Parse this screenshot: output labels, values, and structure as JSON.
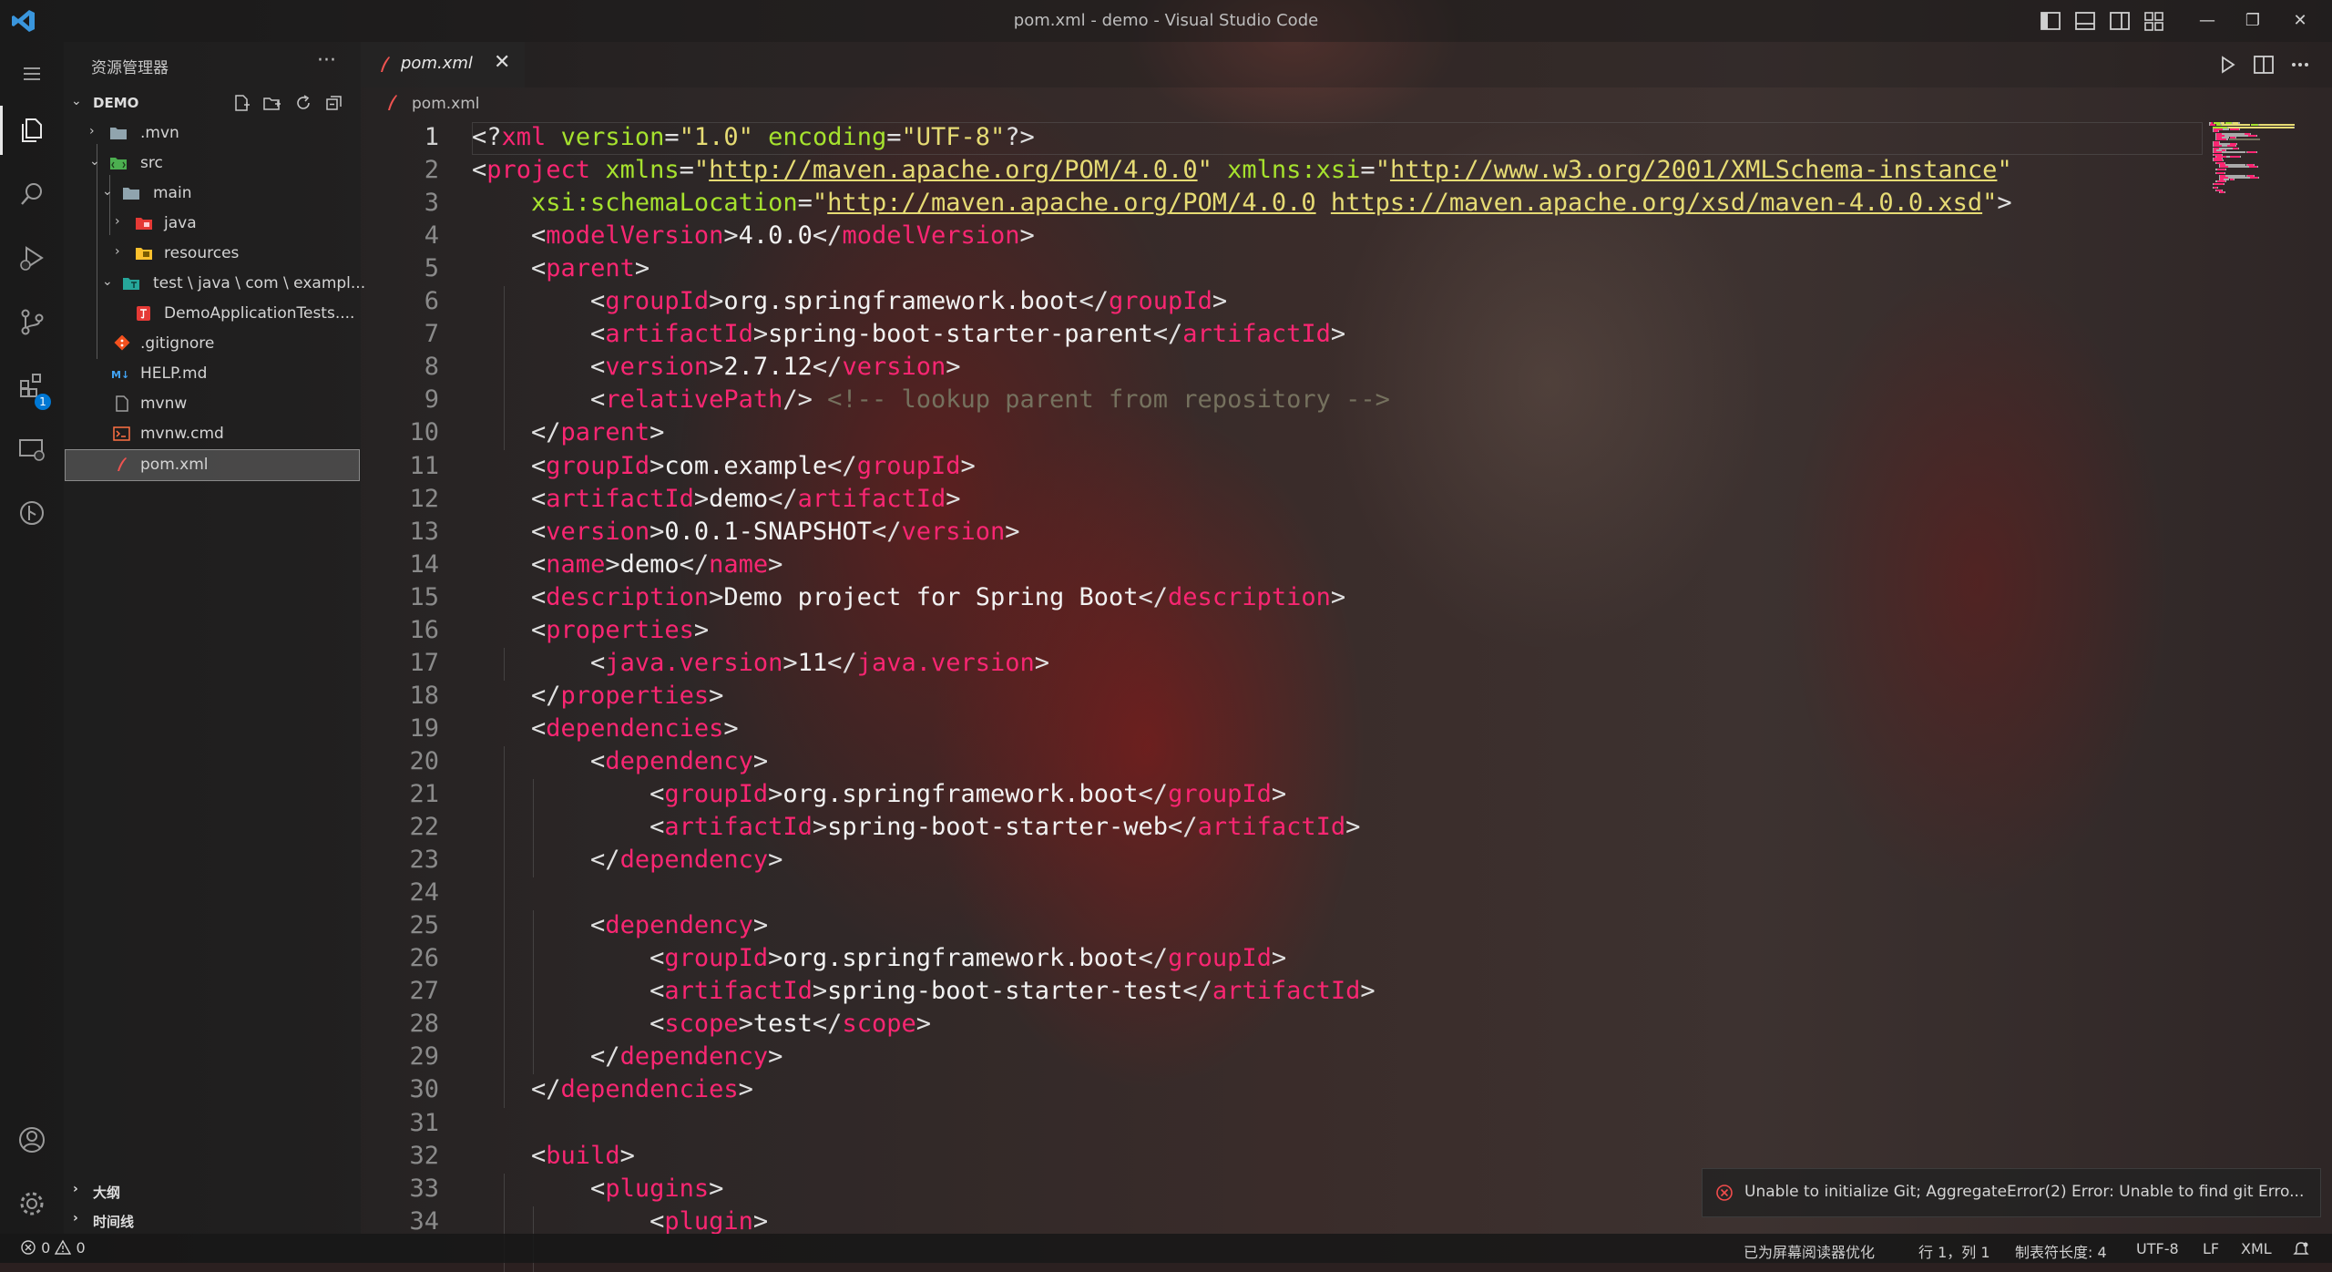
{
  "window": {
    "title": "pom.xml - demo - Visual Studio Code"
  },
  "titlebar": {
    "window_controls": [
      "—",
      "❐",
      "✕"
    ],
    "colors": {
      "accent": "#0078d4"
    }
  },
  "activity_bar": {
    "icons": [
      "menu-icon",
      "files-icon",
      "search-icon",
      "run-debug-icon",
      "source-control-icon",
      "extensions-icon",
      "remote-explorer-icon",
      "git-graph-icon",
      "account-icon",
      "gear-icon"
    ],
    "extensions_badge": "1"
  },
  "sidebar": {
    "title": "资源管理器",
    "more": "···",
    "root": "DEMO",
    "tree": [
      {
        "label": ".mvn",
        "chev": "›"
      },
      {
        "label": "src",
        "chev": "⌄"
      },
      {
        "label": "main",
        "chev": "⌄"
      },
      {
        "label": "java",
        "chev": "›"
      },
      {
        "label": "resources",
        "chev": "›"
      },
      {
        "label": "test \\ java \\ com \\ exampl...",
        "chev": "⌄"
      },
      {
        "label": "DemoApplicationTests...."
      },
      {
        "label": ".gitignore"
      },
      {
        "label": "HELP.md"
      },
      {
        "label": "mvnw"
      },
      {
        "label": "mvnw.cmd"
      },
      {
        "label": "pom.xml"
      }
    ],
    "outline": "大纲",
    "timeline": "时间线"
  },
  "tabs": [
    {
      "label": "pom.xml",
      "close": "✕"
    }
  ],
  "breadcrumb": {
    "file": "pom.xml"
  },
  "editor": {
    "line_numbers": [
      "1",
      "2",
      "3",
      "4",
      "5",
      "6",
      "7",
      "8",
      "9",
      "10",
      "11",
      "12",
      "13",
      "14",
      "15",
      "16",
      "17",
      "18",
      "19",
      "20",
      "21",
      "22",
      "23",
      "24",
      "25",
      "26",
      "27",
      "28",
      "29",
      "30",
      "31",
      "32",
      "33",
      "34"
    ],
    "lines": [
      [
        [
          "br",
          "<?"
        ],
        [
          "tag",
          "xml"
        ],
        [
          "txt",
          " "
        ],
        [
          "attr",
          "version"
        ],
        [
          "br",
          "="
        ],
        [
          "str",
          "\"1.0\""
        ],
        [
          "txt",
          " "
        ],
        [
          "attr",
          "encoding"
        ],
        [
          "br",
          "="
        ],
        [
          "str",
          "\"UTF-8\""
        ],
        [
          "br",
          "?>"
        ]
      ],
      [
        [
          "br",
          "<"
        ],
        [
          "tag",
          "project"
        ],
        [
          "txt",
          " "
        ],
        [
          "attr",
          "xmlns"
        ],
        [
          "br",
          "="
        ],
        [
          "str",
          "\""
        ],
        [
          "url",
          "http://maven.apache.org/POM/4.0.0"
        ],
        [
          "str",
          "\""
        ],
        [
          "txt",
          " "
        ],
        [
          "attr",
          "xmlns:xsi"
        ],
        [
          "br",
          "="
        ],
        [
          "str",
          "\""
        ],
        [
          "url",
          "http://www.w3.org/2001/XMLSchema-instance"
        ],
        [
          "str",
          "\""
        ]
      ],
      [
        [
          "txt",
          "    "
        ],
        [
          "attr",
          "xsi:schemaLocation"
        ],
        [
          "br",
          "="
        ],
        [
          "str",
          "\""
        ],
        [
          "url",
          "http://maven.apache.org/POM/4.0.0"
        ],
        [
          "str",
          " "
        ],
        [
          "url",
          "https://maven.apache.org/xsd/maven-4.0.0.xsd"
        ],
        [
          "str",
          "\""
        ],
        [
          "br",
          ">"
        ]
      ],
      [
        [
          "txt",
          "    "
        ],
        [
          "br",
          "<"
        ],
        [
          "tag",
          "modelVersion"
        ],
        [
          "br",
          ">"
        ],
        [
          "txt",
          "4.0.0"
        ],
        [
          "br",
          "</"
        ],
        [
          "tag",
          "modelVersion"
        ],
        [
          "br",
          ">"
        ]
      ],
      [
        [
          "txt",
          "    "
        ],
        [
          "br",
          "<"
        ],
        [
          "tag",
          "parent"
        ],
        [
          "br",
          ">"
        ]
      ],
      [
        [
          "txt",
          "        "
        ],
        [
          "br",
          "<"
        ],
        [
          "tag",
          "groupId"
        ],
        [
          "br",
          ">"
        ],
        [
          "txt",
          "org.springframework.boot"
        ],
        [
          "br",
          "</"
        ],
        [
          "tag",
          "groupId"
        ],
        [
          "br",
          ">"
        ]
      ],
      [
        [
          "txt",
          "        "
        ],
        [
          "br",
          "<"
        ],
        [
          "tag",
          "artifactId"
        ],
        [
          "br",
          ">"
        ],
        [
          "txt",
          "spring-boot-starter-parent"
        ],
        [
          "br",
          "</"
        ],
        [
          "tag",
          "artifactId"
        ],
        [
          "br",
          ">"
        ]
      ],
      [
        [
          "txt",
          "        "
        ],
        [
          "br",
          "<"
        ],
        [
          "tag",
          "version"
        ],
        [
          "br",
          ">"
        ],
        [
          "txt",
          "2.7.12"
        ],
        [
          "br",
          "</"
        ],
        [
          "tag",
          "version"
        ],
        [
          "br",
          ">"
        ]
      ],
      [
        [
          "txt",
          "        "
        ],
        [
          "br",
          "<"
        ],
        [
          "tag",
          "relativePath"
        ],
        [
          "br",
          "/>"
        ],
        [
          "txt",
          " "
        ],
        [
          "com",
          "<!-- lookup parent from repository -->"
        ]
      ],
      [
        [
          "txt",
          "    "
        ],
        [
          "br",
          "</"
        ],
        [
          "tag",
          "parent"
        ],
        [
          "br",
          ">"
        ]
      ],
      [
        [
          "txt",
          "    "
        ],
        [
          "br",
          "<"
        ],
        [
          "tag",
          "groupId"
        ],
        [
          "br",
          ">"
        ],
        [
          "txt",
          "com.example"
        ],
        [
          "br",
          "</"
        ],
        [
          "tag",
          "groupId"
        ],
        [
          "br",
          ">"
        ]
      ],
      [
        [
          "txt",
          "    "
        ],
        [
          "br",
          "<"
        ],
        [
          "tag",
          "artifactId"
        ],
        [
          "br",
          ">"
        ],
        [
          "txt",
          "demo"
        ],
        [
          "br",
          "</"
        ],
        [
          "tag",
          "artifactId"
        ],
        [
          "br",
          ">"
        ]
      ],
      [
        [
          "txt",
          "    "
        ],
        [
          "br",
          "<"
        ],
        [
          "tag",
          "version"
        ],
        [
          "br",
          ">"
        ],
        [
          "txt",
          "0.0.1-SNAPSHOT"
        ],
        [
          "br",
          "</"
        ],
        [
          "tag",
          "version"
        ],
        [
          "br",
          ">"
        ]
      ],
      [
        [
          "txt",
          "    "
        ],
        [
          "br",
          "<"
        ],
        [
          "tag",
          "name"
        ],
        [
          "br",
          ">"
        ],
        [
          "txt",
          "demo"
        ],
        [
          "br",
          "</"
        ],
        [
          "tag",
          "name"
        ],
        [
          "br",
          ">"
        ]
      ],
      [
        [
          "txt",
          "    "
        ],
        [
          "br",
          "<"
        ],
        [
          "tag",
          "description"
        ],
        [
          "br",
          ">"
        ],
        [
          "txt",
          "Demo project for Spring Boot"
        ],
        [
          "br",
          "</"
        ],
        [
          "tag",
          "description"
        ],
        [
          "br",
          ">"
        ]
      ],
      [
        [
          "txt",
          "    "
        ],
        [
          "br",
          "<"
        ],
        [
          "tag",
          "properties"
        ],
        [
          "br",
          ">"
        ]
      ],
      [
        [
          "txt",
          "        "
        ],
        [
          "br",
          "<"
        ],
        [
          "tag",
          "java.version"
        ],
        [
          "br",
          ">"
        ],
        [
          "txt",
          "11"
        ],
        [
          "br",
          "</"
        ],
        [
          "tag",
          "java.version"
        ],
        [
          "br",
          ">"
        ]
      ],
      [
        [
          "txt",
          "    "
        ],
        [
          "br",
          "</"
        ],
        [
          "tag",
          "properties"
        ],
        [
          "br",
          ">"
        ]
      ],
      [
        [
          "txt",
          "    "
        ],
        [
          "br",
          "<"
        ],
        [
          "tag",
          "dependencies"
        ],
        [
          "br",
          ">"
        ]
      ],
      [
        [
          "txt",
          "        "
        ],
        [
          "br",
          "<"
        ],
        [
          "tag",
          "dependency"
        ],
        [
          "br",
          ">"
        ]
      ],
      [
        [
          "txt",
          "            "
        ],
        [
          "br",
          "<"
        ],
        [
          "tag",
          "groupId"
        ],
        [
          "br",
          ">"
        ],
        [
          "txt",
          "org.springframework.boot"
        ],
        [
          "br",
          "</"
        ],
        [
          "tag",
          "groupId"
        ],
        [
          "br",
          ">"
        ]
      ],
      [
        [
          "txt",
          "            "
        ],
        [
          "br",
          "<"
        ],
        [
          "tag",
          "artifactId"
        ],
        [
          "br",
          ">"
        ],
        [
          "txt",
          "spring-boot-starter-web"
        ],
        [
          "br",
          "</"
        ],
        [
          "tag",
          "artifactId"
        ],
        [
          "br",
          ">"
        ]
      ],
      [
        [
          "txt",
          "        "
        ],
        [
          "br",
          "</"
        ],
        [
          "tag",
          "dependency"
        ],
        [
          "br",
          ">"
        ]
      ],
      [],
      [
        [
          "txt",
          "        "
        ],
        [
          "br",
          "<"
        ],
        [
          "tag",
          "dependency"
        ],
        [
          "br",
          ">"
        ]
      ],
      [
        [
          "txt",
          "            "
        ],
        [
          "br",
          "<"
        ],
        [
          "tag",
          "groupId"
        ],
        [
          "br",
          ">"
        ],
        [
          "txt",
          "org.springframework.boot"
        ],
        [
          "br",
          "</"
        ],
        [
          "tag",
          "groupId"
        ],
        [
          "br",
          ">"
        ]
      ],
      [
        [
          "txt",
          "            "
        ],
        [
          "br",
          "<"
        ],
        [
          "tag",
          "artifactId"
        ],
        [
          "br",
          ">"
        ],
        [
          "txt",
          "spring-boot-starter-test"
        ],
        [
          "br",
          "</"
        ],
        [
          "tag",
          "artifactId"
        ],
        [
          "br",
          ">"
        ]
      ],
      [
        [
          "txt",
          "            "
        ],
        [
          "br",
          "<"
        ],
        [
          "tag",
          "scope"
        ],
        [
          "br",
          ">"
        ],
        [
          "txt",
          "test"
        ],
        [
          "br",
          "</"
        ],
        [
          "tag",
          "scope"
        ],
        [
          "br",
          ">"
        ]
      ],
      [
        [
          "txt",
          "        "
        ],
        [
          "br",
          "</"
        ],
        [
          "tag",
          "dependency"
        ],
        [
          "br",
          ">"
        ]
      ],
      [
        [
          "txt",
          "    "
        ],
        [
          "br",
          "</"
        ],
        [
          "tag",
          "dependencies"
        ],
        [
          "br",
          ">"
        ]
      ],
      [],
      [
        [
          "txt",
          "    "
        ],
        [
          "br",
          "<"
        ],
        [
          "tag",
          "build"
        ],
        [
          "br",
          ">"
        ]
      ],
      [
        [
          "txt",
          "        "
        ],
        [
          "br",
          "<"
        ],
        [
          "tag",
          "plugins"
        ],
        [
          "br",
          ">"
        ]
      ],
      [
        [
          "txt",
          "            "
        ],
        [
          "br",
          "<"
        ],
        [
          "tag",
          "plugin"
        ],
        [
          "br",
          ">"
        ]
      ]
    ],
    "syntax_colors": {
      "tag": "#f92672",
      "attr": "#a6e22e",
      "string": "#e6db74",
      "comment": "#75715e",
      "text": "#f2f2f2"
    }
  },
  "notification": {
    "text": "Unable to initialize Git; AggregateError(2) Error: Unable to find git Erro...",
    "severity_color": "#f14c4c"
  },
  "statusbar": {
    "errors": "0",
    "warnings": "0",
    "screen_reader": "已为屏幕阅读器优化",
    "position": "行 1，列 1",
    "tab_size": "制表符长度: 4",
    "encoding": "UTF-8",
    "eol": "LF",
    "language": "XML"
  }
}
